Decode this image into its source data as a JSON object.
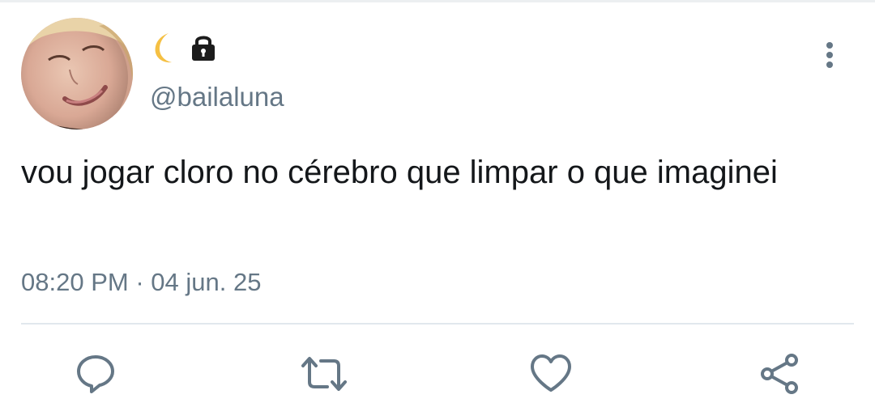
{
  "tweet": {
    "display_name_emoji": [
      "moon",
      "lock"
    ],
    "handle": "@bailaluna",
    "text": "vou jogar cloro no cérebro que limpar o que imaginei",
    "time": "08:20 PM",
    "separator": "·",
    "date": "04 jun. 25"
  },
  "actions": [
    "reply-icon",
    "retweet-icon",
    "like-icon",
    "share-icon"
  ],
  "colors": {
    "text": "#14171a",
    "muted": "#657786",
    "divider": "#e1e8ed",
    "icon": "#657786",
    "moon": "#f5c043"
  }
}
